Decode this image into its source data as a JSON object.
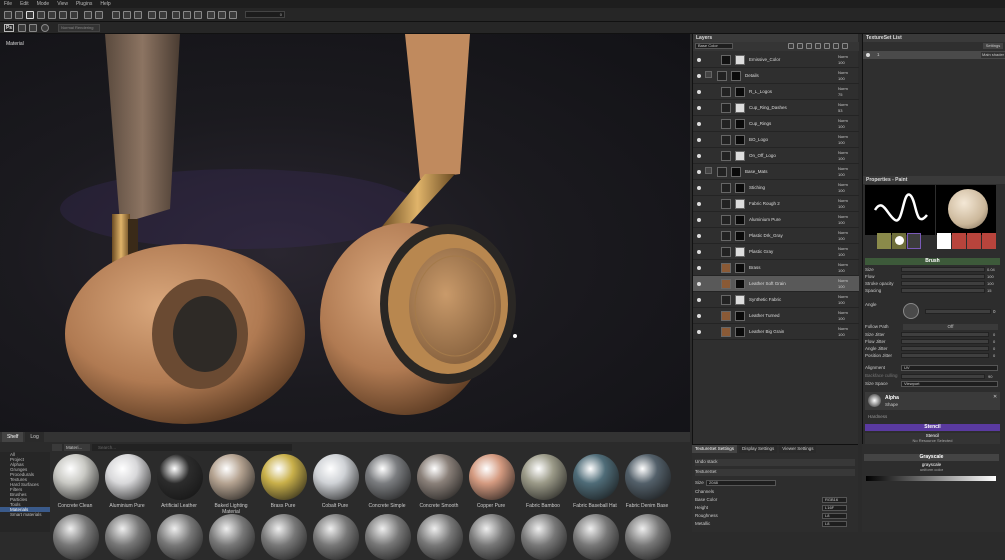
{
  "menu": [
    "File",
    "Edit",
    "Mode",
    "View",
    "Plugins",
    "Help"
  ],
  "toolbar": {
    "ps_label": "Ps",
    "mode_label": "Normal Rendering",
    "value": "0"
  },
  "viewport": {
    "label": "Material"
  },
  "layers": {
    "title": "Layers",
    "channel": "Base Color",
    "rows": [
      {
        "name": "Emissive_Color",
        "blend": "Norm",
        "opacity": "100",
        "type": "fill"
      },
      {
        "name": "Details",
        "blend": "Norm",
        "opacity": "100",
        "type": "folder"
      },
      {
        "name": "R_L_Logos",
        "blend": "Norm",
        "opacity": "75",
        "type": "mask"
      },
      {
        "name": "Cup_Ring_Dashes",
        "blend": "Norm",
        "opacity": "53",
        "type": "mask"
      },
      {
        "name": "Cup_Rings",
        "blend": "Norm",
        "opacity": "100",
        "type": "mask"
      },
      {
        "name": "BO_Logo",
        "blend": "Norm",
        "opacity": "100",
        "type": "mask"
      },
      {
        "name": "On_Off_Logo",
        "blend": "Norm",
        "opacity": "100",
        "type": "mask"
      },
      {
        "name": "Base_Mats",
        "blend": "Norm",
        "opacity": "100",
        "type": "folder"
      },
      {
        "name": "Stiching",
        "blend": "Norm",
        "opacity": "100",
        "type": "mask"
      },
      {
        "name": "Fabric Rough 2",
        "blend": "Norm",
        "opacity": "100",
        "type": "mask"
      },
      {
        "name": "Aluminium Pure",
        "blend": "Norm",
        "opacity": "100",
        "type": "mask"
      },
      {
        "name": "Plastic Drk_Gray",
        "blend": "Norm",
        "opacity": "100",
        "type": "mask"
      },
      {
        "name": "Plastic Gray",
        "blend": "Norm",
        "opacity": "100",
        "type": "mask"
      },
      {
        "name": "Brass",
        "blend": "Norm",
        "opacity": "100",
        "type": "mask"
      },
      {
        "name": "Leather Soft Grain",
        "blend": "Norm",
        "opacity": "100",
        "type": "mask",
        "selected": true
      },
      {
        "name": "Synthetic Fabric",
        "blend": "Norm",
        "opacity": "100",
        "type": "mask"
      },
      {
        "name": "Leather Turned",
        "blend": "Norm",
        "opacity": "100",
        "type": "mask"
      },
      {
        "name": "Leather Big Grain",
        "blend": "Norm",
        "opacity": "100",
        "type": "mask"
      }
    ]
  },
  "textureset_list": {
    "title": "TextureSet List",
    "settings": "Settings",
    "item": "1",
    "shader": "Main shader"
  },
  "properties": {
    "title": "Properties - Paint",
    "thumbs": [
      "brush",
      "alpha",
      "stencil",
      "color",
      "height",
      "rough",
      "metal"
    ],
    "brush_section": "Brush",
    "params": [
      {
        "label": "Size",
        "value": "0.04"
      },
      {
        "label": "Flow",
        "value": "100"
      },
      {
        "label": "Stroke opacity",
        "value": "100"
      },
      {
        "label": "Spacing",
        "value": "15"
      }
    ],
    "angle_label": "Angle",
    "angle_value": "0",
    "follow_path": "Follow Path",
    "follow_value": "Off",
    "jitters": [
      {
        "label": "Size Jitter",
        "value": "0"
      },
      {
        "label": "Flow Jitter",
        "value": "0"
      },
      {
        "label": "Angle Jitter",
        "value": "0"
      },
      {
        "label": "Position Jitter",
        "value": "0"
      }
    ],
    "alignment_label": "Alignment",
    "alignment_value": "UV",
    "backface": "Backface culling",
    "backface_value": "90",
    "size_space_label": "Size Space",
    "size_space_value": "Viewport",
    "alpha_title": "Alpha",
    "alpha_sub": "Shape",
    "hardness": "Hardness",
    "stencil_section": "Stencil",
    "stencil_name": "Stencil",
    "stencil_sub": "No Resource Selected",
    "grayscale_section": "Grayscale",
    "grayscale_name": "grayscale",
    "grayscale_sub": "uniform color"
  },
  "shelf": {
    "tabs": [
      "Shelf",
      "Log"
    ],
    "filter": "Materi...",
    "search_placeholder": "Search...",
    "categories": [
      "All",
      "Project",
      "Alphas",
      "Grunges",
      "Procedurals",
      "Textures",
      "Hard Surfaces",
      "Filters",
      "Brushes",
      "Particles",
      "Tools",
      "Materials",
      "Smart materials"
    ],
    "materials": [
      {
        "name": "Concrete Clean",
        "color": "#c9c9c4"
      },
      {
        "name": "Aluminium Pure",
        "color": "#d8d8da"
      },
      {
        "name": "Artificial Leather",
        "color": "#2c2c2c"
      },
      {
        "name": "Baked Lighting Material",
        "color": "#b5a391"
      },
      {
        "name": "Brass Pure",
        "color": "#c9b04a"
      },
      {
        "name": "Cobalt Pure",
        "color": "#cfd2d6"
      },
      {
        "name": "Concrete Simple",
        "color": "#7b7d80"
      },
      {
        "name": "Concrete Smooth",
        "color": "#8a8079"
      },
      {
        "name": "Copper Pure",
        "color": "#d49a80"
      },
      {
        "name": "Fabric Bamboo",
        "color": "#9b9a88"
      },
      {
        "name": "Fabric Baseball Hat",
        "color": "#4f6c78"
      },
      {
        "name": "Fabric Denim Base",
        "color": "#53606a"
      }
    ]
  },
  "textureset_settings": {
    "tabs": [
      "TextureSet Settings",
      "Display Settings",
      "Viewer Settings"
    ],
    "undo": "Undo stack",
    "texset": "TextureSet",
    "size_label": "Size",
    "size_value": "2048",
    "channels_label": "Channels",
    "channels": [
      {
        "name": "Base Color",
        "fmt": "RGB16"
      },
      {
        "name": "Height",
        "fmt": "L16F"
      },
      {
        "name": "Roughness",
        "fmt": "L8"
      },
      {
        "name": "Metallic",
        "fmt": "L8"
      }
    ]
  }
}
